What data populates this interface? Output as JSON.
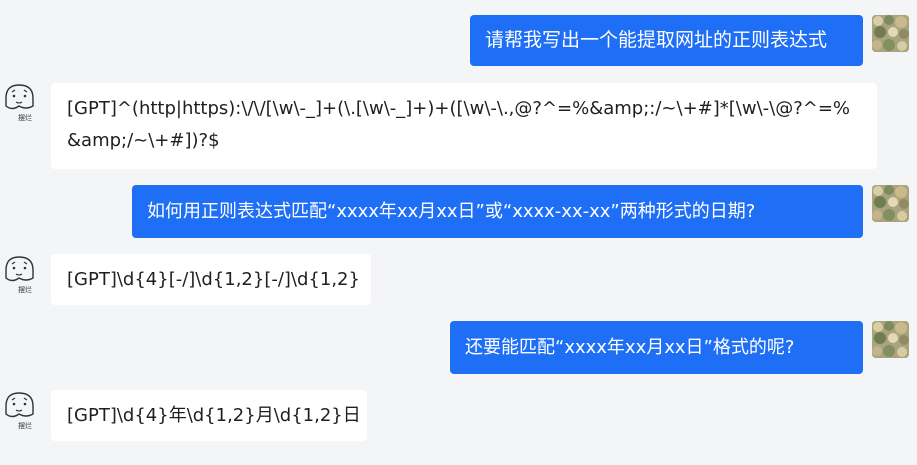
{
  "conversation": {
    "messages": [
      {
        "role": "user",
        "text": "请帮我写出一个能提取网址的正则表达式"
      },
      {
        "role": "bot",
        "text": "[GPT]^(http|https):\\/\\/[\\w\\-_]+(\\.[\\w\\-_]+)+([\\w\\-\\.,@?^=%&amp;:/~\\+#]*[\\w\\-\\@?^=%&amp;/~\\+#])?$"
      },
      {
        "role": "user",
        "text": "如何用正则表达式匹配“xxxx年xx月xx日”或“xxxx-xx-xx”两种形式的日期?"
      },
      {
        "role": "bot",
        "text": "[GPT]\\d{4}[-/]\\d{1,2}[-/]\\d{1,2}"
      },
      {
        "role": "user",
        "text": "还要能匹配“xxxx年xx月xx日”格式的呢?"
      },
      {
        "role": "bot",
        "text": "[GPT]\\d{4}年\\d{1,2}月\\d{1,2}日"
      }
    ],
    "bot_avatar_caption": "摆烂",
    "colors": {
      "user_bubble": "#1e6ff6",
      "bot_bubble": "#ffffff",
      "background": "#f4f5f7"
    }
  }
}
